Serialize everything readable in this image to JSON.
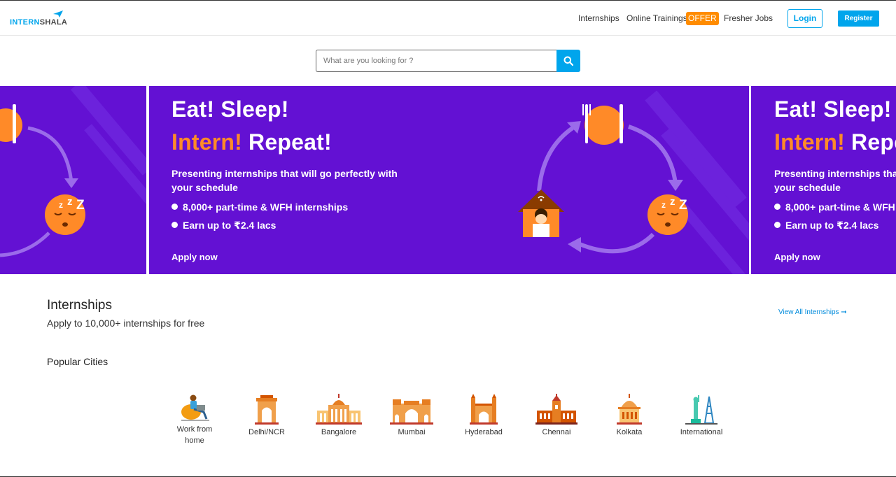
{
  "header": {
    "logo_main": "INTERN",
    "logo_accent": "SHALA",
    "nav": {
      "internships": "Internships",
      "online_trainings": "Online Trainings",
      "offer_badge": "OFFER",
      "fresher_jobs": "Fresher Jobs"
    },
    "login_label": "Login",
    "register_label": "Register"
  },
  "search": {
    "placeholder": "What are you looking for ?",
    "icon": "search-icon"
  },
  "banner": {
    "line1": "Eat! Sleep!",
    "line2_accent": "Intern!",
    "line2_rest": "Repeat!",
    "description": "Presenting internships that will go perfectly with your schedule",
    "description_line1": "Presenting internships that will go perfectly with",
    "description_line2": "your schedule",
    "bullet1": "8,000+ part-time & WFH internships",
    "bullet2": "Earn up to ₹2.4 lacs",
    "cta": "Apply now",
    "colors": {
      "background": "#6311d3",
      "accent": "#ff8a28"
    }
  },
  "internships_section": {
    "title": "Internships",
    "subtitle": "Apply to 10,000+ internships for free",
    "view_all": "View All Internships ➞",
    "popular_cities_title": "Popular Cities",
    "cities": [
      {
        "label": "Work from home",
        "line1": "Work from",
        "line2": "home",
        "icon": "work-from-home-icon"
      },
      {
        "label": "Delhi/NCR",
        "icon": "india-gate-icon"
      },
      {
        "label": "Bangalore",
        "icon": "vidhana-soudha-icon"
      },
      {
        "label": "Mumbai",
        "icon": "gateway-of-india-icon"
      },
      {
        "label": "Hyderabad",
        "icon": "charminar-icon"
      },
      {
        "label": "Chennai",
        "icon": "chennai-central-icon"
      },
      {
        "label": "Kolkata",
        "icon": "victoria-memorial-icon"
      },
      {
        "label": "International",
        "icon": "statue-of-liberty-icon"
      }
    ]
  },
  "colors": {
    "brand": "#00a5ec",
    "offer": "#ff8c00"
  }
}
